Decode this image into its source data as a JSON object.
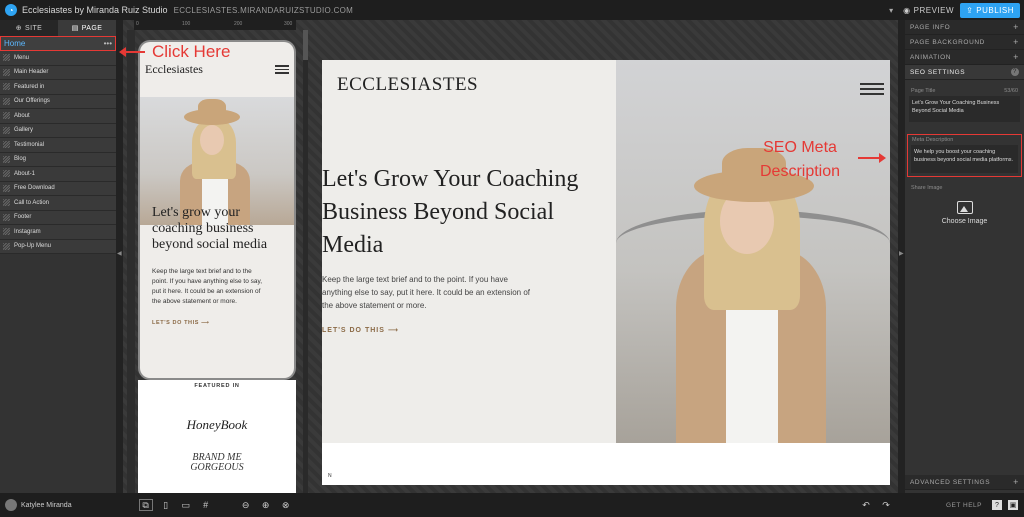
{
  "app": {
    "title": "Ecclesiastes by Miranda Ruiz Studio",
    "url": "ECCLESIASTES.MIRANDARUIZSTUDIO.COM",
    "preview_label": "PREVIEW",
    "publish_label": "PUBLISH",
    "accent": "#2ea3f2"
  },
  "left_panel": {
    "tabs": [
      "SITE",
      "PAGE"
    ],
    "home_label": "Home",
    "sections": [
      "Menu",
      "Main Header",
      "Featured in",
      "Our Offerings",
      "About",
      "Gallery",
      "Testimonial",
      "Blog",
      "About-1",
      "Free Download",
      "Call to Action",
      "Footer",
      "Instagram",
      "Pop-Up Menu"
    ]
  },
  "ruler": {
    "ticks": [
      "0",
      "100",
      "200",
      "300"
    ]
  },
  "mobile_preview": {
    "logo": "Ecclesiastes",
    "headline": "Let's grow your coaching business beyond social media",
    "body": "Keep the large text brief and to the point. If you have anything else to say, put it here. It could be an extension of the above statement or more.",
    "cta": "LET'S DO THIS",
    "featured_label": "FEATURED IN",
    "logo1": "HoneyBook",
    "logo2_line1": "BRAND ME",
    "logo2_line2": "GORGEOUS"
  },
  "desktop_preview": {
    "logo": "ECCLESIASTES",
    "headline": "Let's Grow Your Coaching Business Beyond Social Media",
    "body": "Keep the large text brief and to the point. If you have anything else to say, put it here. It could be an extension of the above statement or more.",
    "cta": "LET'S DO THIS",
    "bottom_letter": "N"
  },
  "right_panel": {
    "accordions": [
      "PAGE INFO",
      "PAGE BACKGROUND",
      "ANIMATION"
    ],
    "seo_label": "SEO SETTINGS",
    "page_title_label": "Page Title",
    "page_title_count": "53/60",
    "page_title_value": "Let's Grow Your Coaching Business Beyond Social Media",
    "meta_label": "Meta Description",
    "meta_value": "We help you boost your coaching business beyond social media platforms.",
    "share_image_label": "Share Image",
    "choose_image_label": "Choose Image",
    "advanced_label": "ADVANCED SETTINGS"
  },
  "bottom_bar": {
    "user_name": "Katylee Miranda",
    "get_help_label": "GET HELP"
  },
  "annotations": {
    "click_here": "Click Here",
    "seo_meta_line1": "SEO Meta",
    "seo_meta_line2": "Description"
  }
}
